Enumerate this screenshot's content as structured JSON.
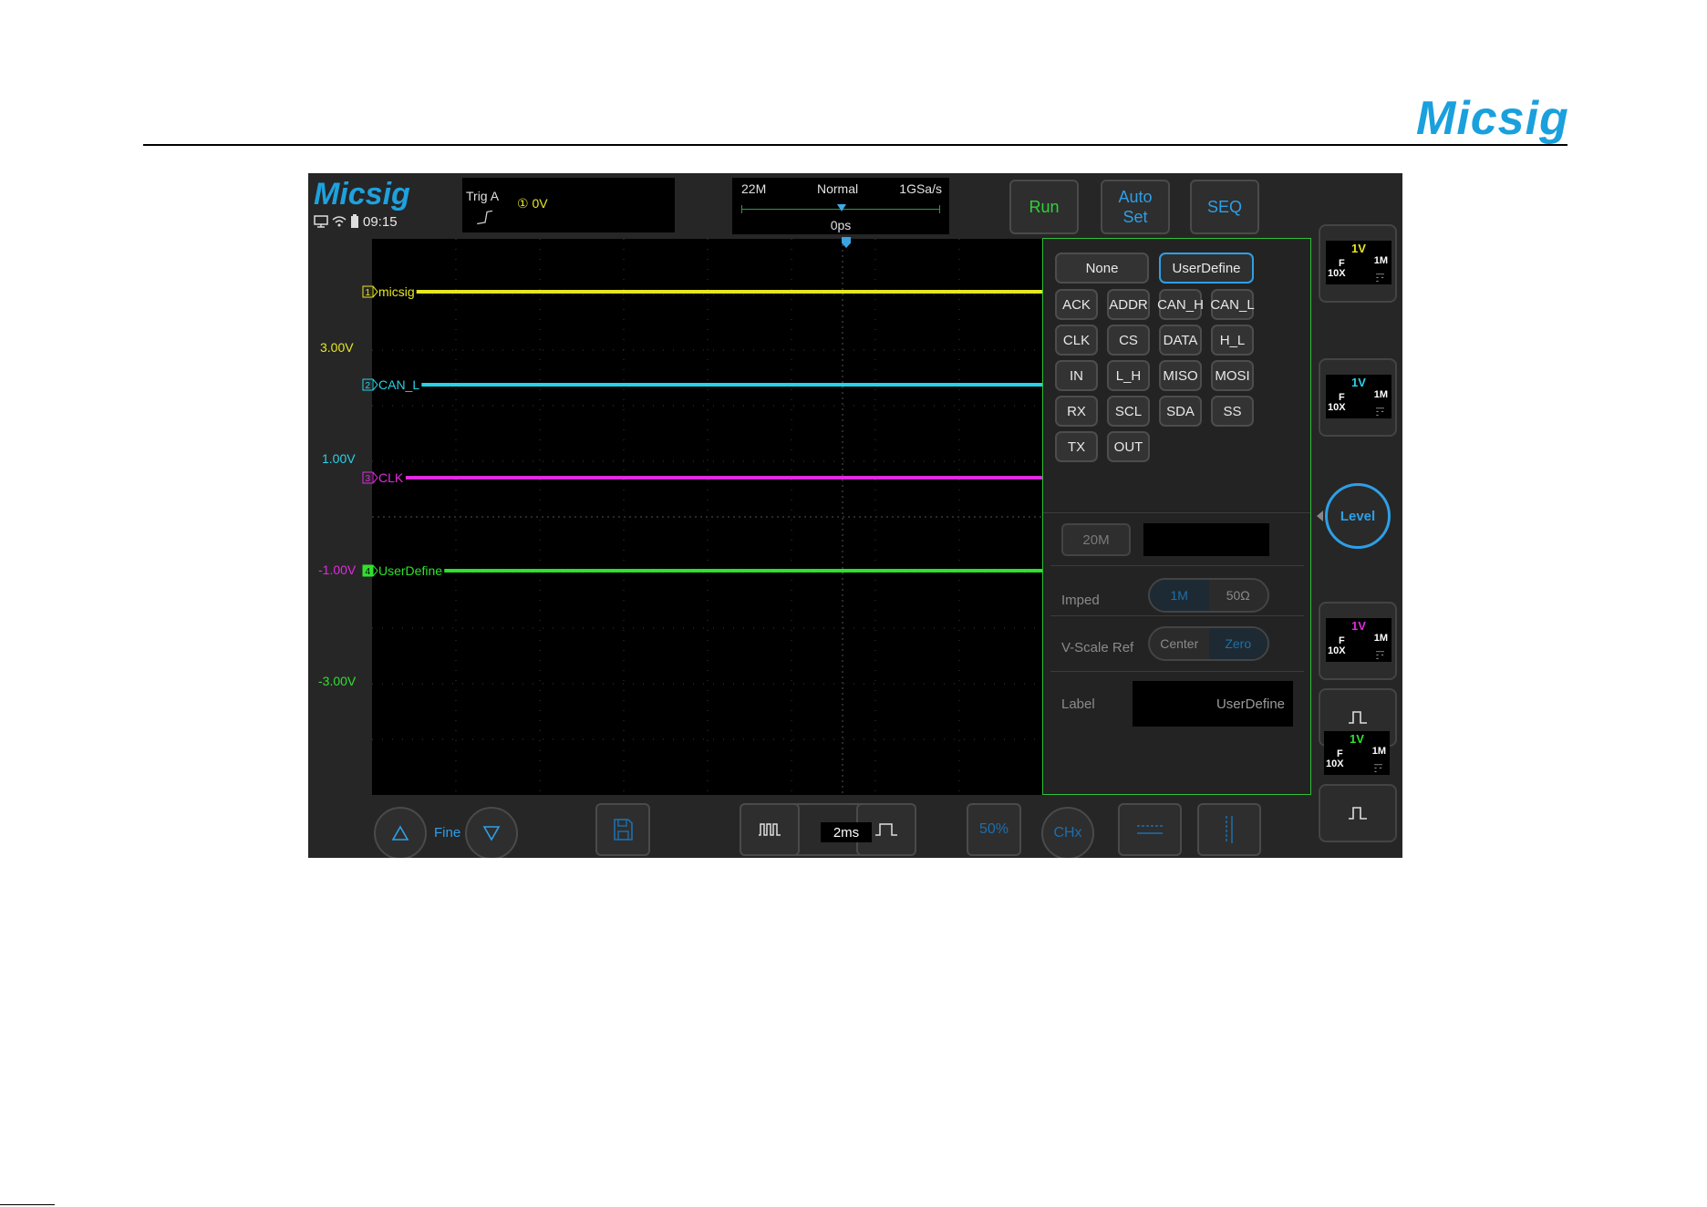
{
  "document": {
    "brand": "Micsig"
  },
  "scope": {
    "logo": "Micsig",
    "status": {
      "time": "09:15",
      "icons": [
        "monitor-icon",
        "wifi-icon",
        "battery-icon"
      ]
    },
    "trigger": {
      "label": "Trig A",
      "source": "① 0V",
      "edge": "rising-edge-icon"
    },
    "timebase_info": {
      "memory": "22M",
      "mode": "Normal",
      "sample_rate": "1GSa/s",
      "offset": "0ps"
    },
    "buttons": {
      "run": "Run",
      "autoset": "Auto\nSet",
      "seq": "SEQ"
    },
    "channels": [
      {
        "level": "3.00V",
        "num": "1",
        "label": "micsig",
        "color": "#e7e720"
      },
      {
        "level": "1.00V",
        "num": "2",
        "label": "CAN_L",
        "color": "#27d3e8"
      },
      {
        "level": "-1.00V",
        "num": "3",
        "label": "CLK",
        "color": "#e02be0"
      },
      {
        "level": "-3.00V",
        "num": "4",
        "label": "UserDefine",
        "color": "#2fe02f"
      }
    ],
    "channel_cards": [
      {
        "volt": "1V",
        "coupling": "F",
        "impedance": "1M",
        "probe": "10X",
        "color": "#e7e720"
      },
      {
        "volt": "1V",
        "coupling": "F",
        "impedance": "1M",
        "probe": "10X",
        "color": "#27d3e8"
      },
      {
        "volt": "1V",
        "coupling": "F",
        "impedance": "1M",
        "probe": "10X",
        "color": "#e02be0"
      },
      {
        "volt": "1V",
        "coupling": "F",
        "impedance": "1M",
        "probe": "10X",
        "color": "#2fe02f"
      }
    ],
    "level_knob": "Level",
    "label_panel": {
      "none": "None",
      "user_define": "UserDefine",
      "presets": [
        "ACK",
        "ADDR",
        "CAN_H",
        "CAN_L",
        "CLK",
        "CS",
        "DATA",
        "H_L",
        "IN",
        "L_H",
        "MISO",
        "MOSI",
        "RX",
        "SCL",
        "SDA",
        "SS",
        "TX",
        "OUT"
      ],
      "bandwidth": "20M",
      "imped_label": "Imped",
      "imped_options": [
        "1M",
        "50Ω"
      ],
      "imped_selected": "1M",
      "vscale_label": "V-Scale Ref",
      "vscale_options": [
        "Center",
        "Zero"
      ],
      "vscale_selected": "Zero",
      "label_label": "Label",
      "label_value": "UserDefine"
    },
    "bottom": {
      "fine": "Fine",
      "timebase": "2ms",
      "fifty": "50%",
      "chx": "CHx"
    },
    "accent": "#2e9fe6"
  }
}
